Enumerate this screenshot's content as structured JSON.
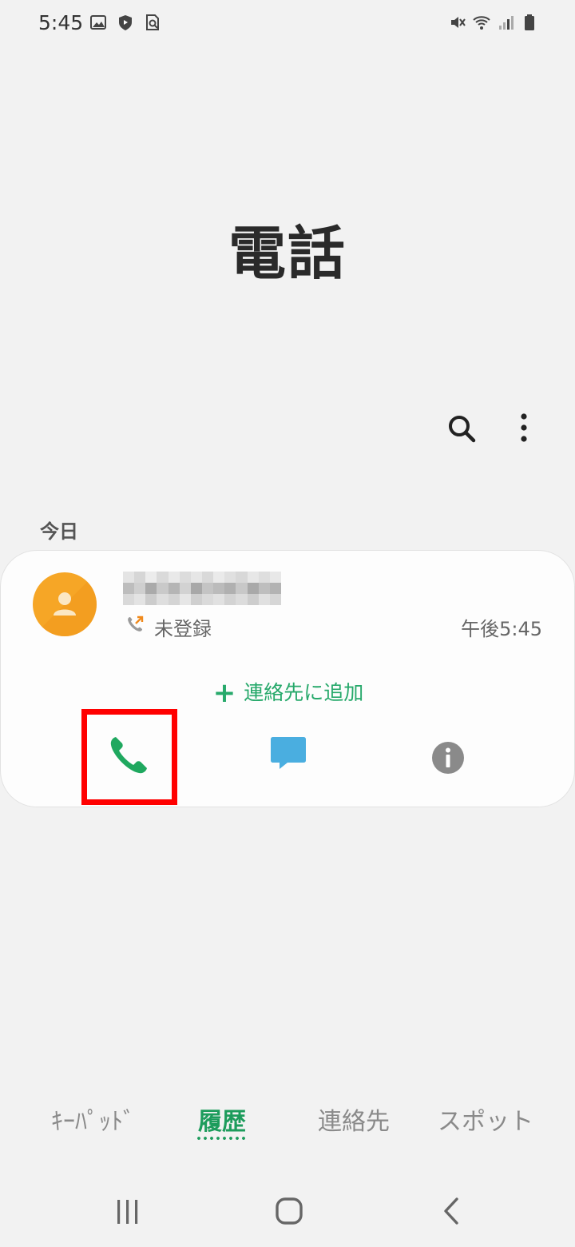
{
  "status_bar": {
    "time": "5:45",
    "left_icons": [
      "image-icon",
      "shield-icon",
      "search-doc-icon"
    ],
    "right_icons": [
      "mute-vibrate-icon",
      "wifi-icon",
      "signal-icon",
      "battery-icon"
    ]
  },
  "header": {
    "title": "電話"
  },
  "toolbar": {
    "search_icon": "search-icon",
    "more_icon": "more-vertical-icon"
  },
  "call_log": {
    "section_label": "今日",
    "entries": [
      {
        "avatar_color": "#f6a626",
        "name_obscured": true,
        "call_type_icon": "outgoing-call-icon",
        "label": "未登録",
        "time": "午後5:45",
        "add_contact_label": "連絡先に追加",
        "actions": [
          "call-icon",
          "message-icon",
          "info-icon"
        ]
      }
    ]
  },
  "highlight": {
    "color": "#ff0000",
    "target": "call-button"
  },
  "bottom_tabs": {
    "items": [
      {
        "label": "ｷｰﾊﾟｯﾄﾞ",
        "active": false
      },
      {
        "label": "履歴",
        "active": true
      },
      {
        "label": "連絡先",
        "active": false
      },
      {
        "label": "スポット",
        "active": false
      }
    ],
    "active_color": "#1d9c5c"
  },
  "nav_bar": {
    "icons": [
      "recent-apps-icon",
      "home-icon",
      "back-icon"
    ]
  },
  "colors": {
    "background": "#f2f2f2",
    "accent_green": "#27a96b",
    "message_blue": "#4aaee0",
    "info_gray": "#8a8a8a"
  }
}
